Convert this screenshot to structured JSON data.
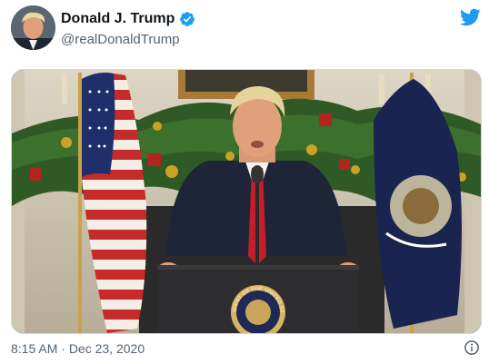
{
  "tweet": {
    "display_name": "Donald J. Trump",
    "handle": "@realDonaldTrump",
    "time": "8:15 AM",
    "separator": "·",
    "date": "Dec 23, 2020"
  },
  "icons": {
    "verified": "verified-badge-icon",
    "logo": "twitter-bird-icon",
    "info": "info-icon"
  },
  "colors": {
    "twitter_blue": "#1d9bf0",
    "text_primary": "#0f1419",
    "text_secondary": "#536471"
  },
  "media": {
    "seal_text": "PRESIDENT OF THE UNITED STATES"
  }
}
